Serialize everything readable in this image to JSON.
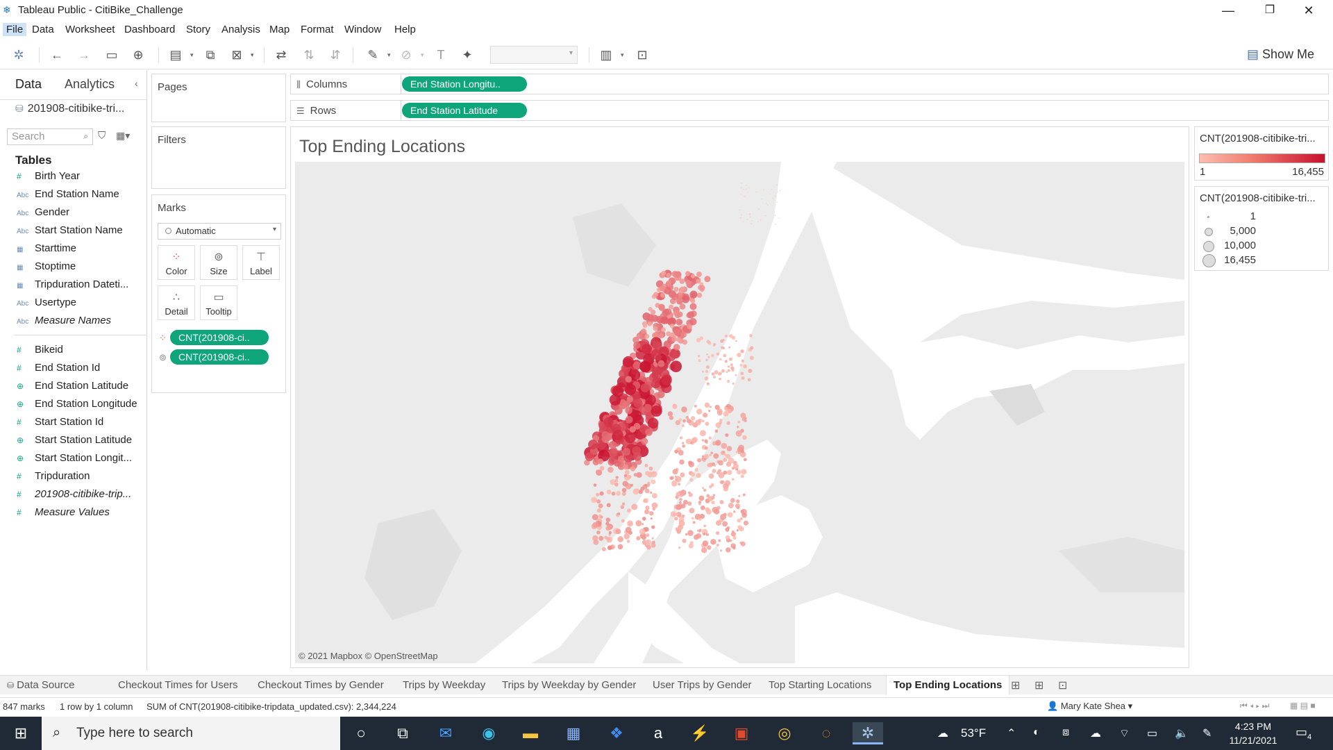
{
  "window": {
    "title": "Tableau Public - CitiBike_Challenge",
    "minimize": "—",
    "restore": "❐",
    "close": "✕"
  },
  "menu": [
    "File",
    "Data",
    "Worksheet",
    "Dashboard",
    "Story",
    "Analysis",
    "Map",
    "Format",
    "Window",
    "Help"
  ],
  "toolbar": {
    "show_me": "Show Me"
  },
  "datapane": {
    "tab_data": "Data",
    "tab_analytics": "Analytics",
    "datasource": "201908-citibike-tri...",
    "search_placeholder": "Search",
    "tables_heading": "Tables",
    "dimensions": [
      {
        "type": "#",
        "kind": "num",
        "name": "Birth Year"
      },
      {
        "type": "Abc",
        "kind": "str",
        "name": "End Station Name"
      },
      {
        "type": "Abc",
        "kind": "str",
        "name": "Gender"
      },
      {
        "type": "Abc",
        "kind": "str",
        "name": "Start Station Name"
      },
      {
        "type": "▦",
        "kind": "date",
        "name": "Starttime"
      },
      {
        "type": "▦",
        "kind": "date",
        "name": "Stoptime"
      },
      {
        "type": "▦",
        "kind": "date",
        "name": "Tripduration Dateti..."
      },
      {
        "type": "Abc",
        "kind": "str",
        "name": "Usertype"
      },
      {
        "type": "Abc",
        "kind": "str",
        "name": "Measure Names"
      }
    ],
    "measures": [
      {
        "type": "#",
        "kind": "num",
        "name": "Bikeid"
      },
      {
        "type": "#",
        "kind": "num",
        "name": "End Station Id"
      },
      {
        "type": "⊕",
        "kind": "geo",
        "name": "End Station Latitude"
      },
      {
        "type": "⊕",
        "kind": "geo",
        "name": "End Station Longitude"
      },
      {
        "type": "#",
        "kind": "num",
        "name": "Start Station Id"
      },
      {
        "type": "⊕",
        "kind": "geo",
        "name": "Start Station Latitude"
      },
      {
        "type": "⊕",
        "kind": "geo",
        "name": "Start Station Longit..."
      },
      {
        "type": "#",
        "kind": "num",
        "name": "Tripduration"
      },
      {
        "type": "#",
        "kind": "num",
        "name": "201908-citibike-trip..."
      },
      {
        "type": "#",
        "kind": "num",
        "name": "Measure Values"
      }
    ]
  },
  "cards": {
    "pages": "Pages",
    "filters": "Filters",
    "marks": "Marks",
    "mark_type": "Automatic",
    "mark_buttons": [
      "Color",
      "Size",
      "Label",
      "Detail",
      "Tooltip"
    ],
    "mark_pills": [
      "CNT(201908-ci..",
      "CNT(201908-ci.."
    ]
  },
  "shelves": {
    "columns_label": "Columns",
    "columns_pill": "End Station Longitu..",
    "rows_label": "Rows",
    "rows_pill": "End Station Latitude"
  },
  "view": {
    "title": "Top Ending Locations",
    "attribution": "© 2021 Mapbox © OpenStreetMap"
  },
  "legend_color": {
    "title": "CNT(201908-citibike-tri...",
    "min": "1",
    "max": "16,455"
  },
  "legend_size": {
    "title": "CNT(201908-citibike-tri...",
    "items": [
      "1",
      "5,000",
      "10,000",
      "16,455"
    ]
  },
  "sheet_tabs": [
    "Data Source",
    "Checkout Times for Users",
    "Checkout Times by Gender",
    "Trips by Weekday",
    "Trips by Weekday by Gender",
    "User Trips by Gender",
    "Top Starting Locations",
    "Top Ending Locations"
  ],
  "status": {
    "marks": "847 marks",
    "rows_cols": "1 row by 1 column",
    "sum": "SUM of CNT(201908-citibike-tripdata_updated.csv): 2,344,224",
    "user": "Mary Kate Shea"
  },
  "taskbar": {
    "search_placeholder": "Type here to search",
    "weather": "53°F",
    "time": "4:23 PM",
    "date": "11/21/2021",
    "notification_count": "4"
  },
  "colors": {
    "pill": "#0fa57b",
    "mark_low": "#fcbdb0",
    "mark_high": "#c8102e"
  }
}
